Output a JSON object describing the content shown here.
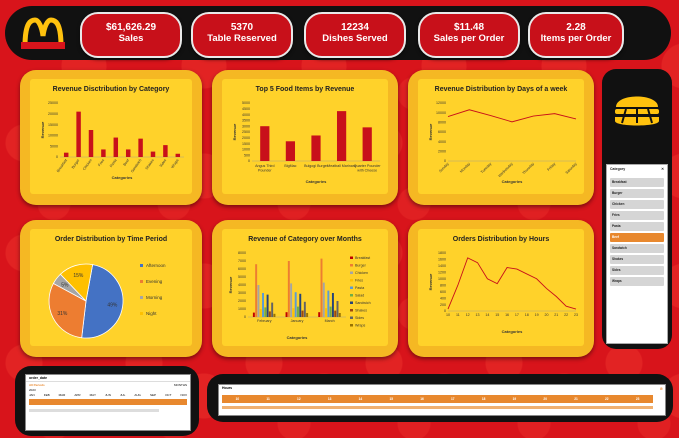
{
  "kpis": [
    {
      "value": "$61,626.29",
      "label": "Sales"
    },
    {
      "value": "5370",
      "label": "Table Reserved"
    },
    {
      "value": "12234",
      "label": "Dishes Served"
    },
    {
      "value": "$11.48",
      "label": "Sales per Order"
    },
    {
      "value": "2.28",
      "label": "Items per Order"
    }
  ],
  "colors": {
    "brand_red": "#d8141b",
    "gold": "#f5b823",
    "bar_red": "#c8101a",
    "accent_orange": "#e8882e"
  },
  "slicer": {
    "header": "Category",
    "items": [
      "Breakfast",
      "Burger",
      "Chicken",
      "Fries",
      "Pasta",
      "Beef",
      "Sandwich",
      "Shakes",
      "Sides",
      "Wraps"
    ],
    "selected": "Beef"
  },
  "timeline_date": {
    "title": "order_date",
    "selection": "All Periods",
    "mode": "MONTHS",
    "year": "2023",
    "months": [
      "JAN",
      "FEB",
      "MAR",
      "APR",
      "MAY",
      "JUN",
      "JUL",
      "AUG",
      "SEP",
      "OCT",
      "NOV"
    ]
  },
  "timeline_hours": {
    "title": "Hours",
    "ticks": [
      "10",
      "11",
      "12",
      "13",
      "14",
      "15",
      "16",
      "17",
      "18",
      "19",
      "20",
      "21",
      "22",
      "23"
    ]
  },
  "chart_data": [
    {
      "type": "bar",
      "title": "Revenue Disctribution by Category",
      "xlabel": "Categories",
      "ylabel": "Revenue",
      "categories": [
        "Breakfast",
        "Burger",
        "Chicken",
        "Fries",
        "Pasta",
        "Beef",
        "Sandwich",
        "Shakes",
        "Sides",
        "Wraps"
      ],
      "values": [
        2000,
        21000,
        12500,
        3500,
        9000,
        3500,
        8500,
        2500,
        5500,
        1500
      ],
      "ylim": [
        0,
        25000
      ],
      "yticks": [
        "0",
        "5000",
        "10000",
        "15000",
        "20000",
        "25000"
      ]
    },
    {
      "type": "bar",
      "title": "Top 5 Food Items by Revenue",
      "xlabel": "Categories",
      "ylabel": "Revenue",
      "categories": [
        "Angus Third Pounder",
        "BigMac",
        "Bulgogi Burger",
        "Meatball Marinara",
        "Quarter Pounder with Cheese"
      ],
      "values": [
        3000,
        1700,
        2200,
        4300,
        2900
      ],
      "ylim": [
        0,
        5000
      ],
      "yticks": [
        "0",
        "500",
        "1000",
        "1500",
        "2000",
        "2500",
        "3000",
        "3500",
        "4000",
        "4500",
        "5000"
      ]
    },
    {
      "type": "line",
      "title": "Revenue Distribution by Days of a week",
      "xlabel": "Categories",
      "ylabel": "Revenue",
      "categories": [
        "Sunday",
        "Monday",
        "Tuesday",
        "Wednesday",
        "Thursday",
        "Friday",
        "Saturday"
      ],
      "values": [
        9200,
        10600,
        9400,
        8100,
        9300,
        9800,
        8700
      ],
      "ylim": [
        0,
        12000
      ],
      "yticks": [
        "0",
        "2000",
        "4000",
        "6000",
        "8000",
        "10000",
        "12000"
      ]
    },
    {
      "type": "pie",
      "title": "Order Distribution by Time Period",
      "categories": [
        "Afternoon",
        "Evening",
        "Morning",
        "Night"
      ],
      "values": [
        49,
        31,
        5,
        15
      ],
      "labels": [
        "49%",
        "31%",
        "5%",
        "15%"
      ],
      "colors": [
        "#4472c4",
        "#ed7d31",
        "#a5a5a5",
        "#ffc000"
      ],
      "legend": "right"
    },
    {
      "type": "bar",
      "title": "Revenue of Category over Months",
      "xlabel": "Categories",
      "ylabel": "Revenue",
      "categories": [
        "February",
        "January",
        "March"
      ],
      "series": [
        {
          "name": "Breakfast",
          "color": "#c00000",
          "values": [
            550,
            600,
            600
          ]
        },
        {
          "name": "Burger",
          "color": "#ed7d31",
          "values": [
            6600,
            7000,
            7300
          ]
        },
        {
          "name": "Chicken",
          "color": "#a5a5a5",
          "values": [
            4000,
            4200,
            4300
          ]
        },
        {
          "name": "Fries",
          "color": "#ffc000",
          "values": [
            1000,
            1100,
            1100
          ]
        },
        {
          "name": "Pasta",
          "color": "#5b9bd5",
          "values": [
            3000,
            3100,
            3300
          ]
        },
        {
          "name": "Salad",
          "color": "#70ad47",
          "values": [
            1200,
            1300,
            1300
          ]
        },
        {
          "name": "Sandwich",
          "color": "#264478",
          "values": [
            2800,
            2900,
            3000
          ]
        },
        {
          "name": "Shakes",
          "color": "#9e480e",
          "values": [
            700,
            800,
            800
          ]
        },
        {
          "name": "Sides",
          "color": "#636363",
          "values": [
            1800,
            1900,
            2000
          ]
        },
        {
          "name": "Wraps",
          "color": "#997300",
          "values": [
            400,
            500,
            500
          ]
        }
      ],
      "ylim": [
        0,
        8000
      ],
      "yticks": [
        "0",
        "1000",
        "2000",
        "3000",
        "4000",
        "5000",
        "6000",
        "7000",
        "8000"
      ],
      "legend": "right"
    },
    {
      "type": "line",
      "title": "Orders Distribution by Hours",
      "xlabel": "Categories",
      "ylabel": "Revenue",
      "categories": [
        "10",
        "11",
        "12",
        "13",
        "14",
        "15",
        "16",
        "17",
        "18",
        "19",
        "20",
        "21",
        "22",
        "23"
      ],
      "values": [
        60,
        800,
        1650,
        1500,
        1000,
        850,
        1350,
        1300,
        1150,
        1000,
        700,
        450,
        150,
        60
      ],
      "ylim": [
        0,
        1800
      ],
      "yticks": [
        "0",
        "200",
        "400",
        "600",
        "800",
        "1000",
        "1200",
        "1400",
        "1600",
        "1800"
      ]
    }
  ]
}
